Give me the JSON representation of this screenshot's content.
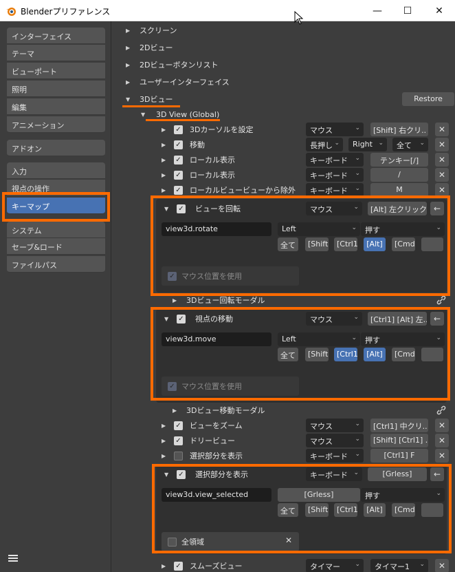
{
  "window": {
    "title": "Blenderプリファレンス",
    "minimize": "—",
    "maximize": "☐",
    "close": "✕"
  },
  "sidebar": {
    "items": [
      "インターフェイス",
      "テーマ",
      "ビューポート",
      "照明",
      "編集",
      "アニメーション",
      "アドオン",
      "入力",
      "視点の操作",
      "キーマップ",
      "システム",
      "セーブ&ロード",
      "ファイルパス"
    ],
    "active": "キーマップ"
  },
  "sections": {
    "screen": "スクリーン",
    "view2d": "2Dビュー",
    "view2d_buttons": "2Dビューボタンリスト",
    "user_interface": "ユーザーインターフェイス",
    "view3d": "3Dビュー",
    "restore": "Restore",
    "view3d_global": "3D View (Global)"
  },
  "rows": {
    "cursor": {
      "label": "3Dカーソルを設定",
      "type": "マウス",
      "key": "[Shift] 右クリ.."
    },
    "move": {
      "label": "移動",
      "type": "長押し",
      "button": "Right",
      "mod": "全て"
    },
    "local1": {
      "label": "ローカル表示",
      "type": "キーボード",
      "key": "テンキー[/]"
    },
    "local2": {
      "label": "ローカル表示",
      "type": "キーボード",
      "key": "/"
    },
    "localexit": {
      "label": "ローカルビュービューから除外",
      "type": "キーボード",
      "key": "M"
    },
    "rotate": {
      "label": "ビューを回転",
      "type": "マウス",
      "key": "[Alt] 左クリック",
      "op": "view3d.rotate",
      "button": "Left",
      "value": "押す",
      "usemouse": "マウス位置を使用"
    },
    "rotate_modal": {
      "label": "3Dビュー回転モーダル"
    },
    "pan": {
      "label": "視点の移動",
      "type": "マウス",
      "key": "[Ctrl1] [Alt] 左..",
      "op": "view3d.move",
      "button": "Left",
      "value": "押す",
      "usemouse": "マウス位置を使用"
    },
    "move_modal": {
      "label": "3Dビュー移動モーダル"
    },
    "zoom": {
      "label": "ビューをズーム",
      "type": "マウス",
      "key": "[Ctrl1] 中クリ.."
    },
    "dolly": {
      "label": "ドリービュー",
      "type": "マウス",
      "key": "[Shift] [Ctrl1] .."
    },
    "selected1": {
      "label": "選択部分を表示",
      "type": "キーボード",
      "key": "[Ctrl1] F"
    },
    "selected2": {
      "label": "選択部分を表示",
      "type": "キーボード",
      "key": "[Grless]",
      "op": "view3d.view_selected",
      "opkey": "[Grless]",
      "value": "押す",
      "allregions": "全領域"
    },
    "smooth": {
      "label": "スムーズビュー",
      "type": "タイマー",
      "key": "タイマー1"
    }
  },
  "modifiers": {
    "any": "全て",
    "shift": "[Shift]",
    "ctrl": "[Ctrl1]",
    "alt": "[Alt]",
    "cmd": "[Cmd"
  },
  "colors": {
    "accent": "#4772b3",
    "highlight": "#ff6a00"
  }
}
